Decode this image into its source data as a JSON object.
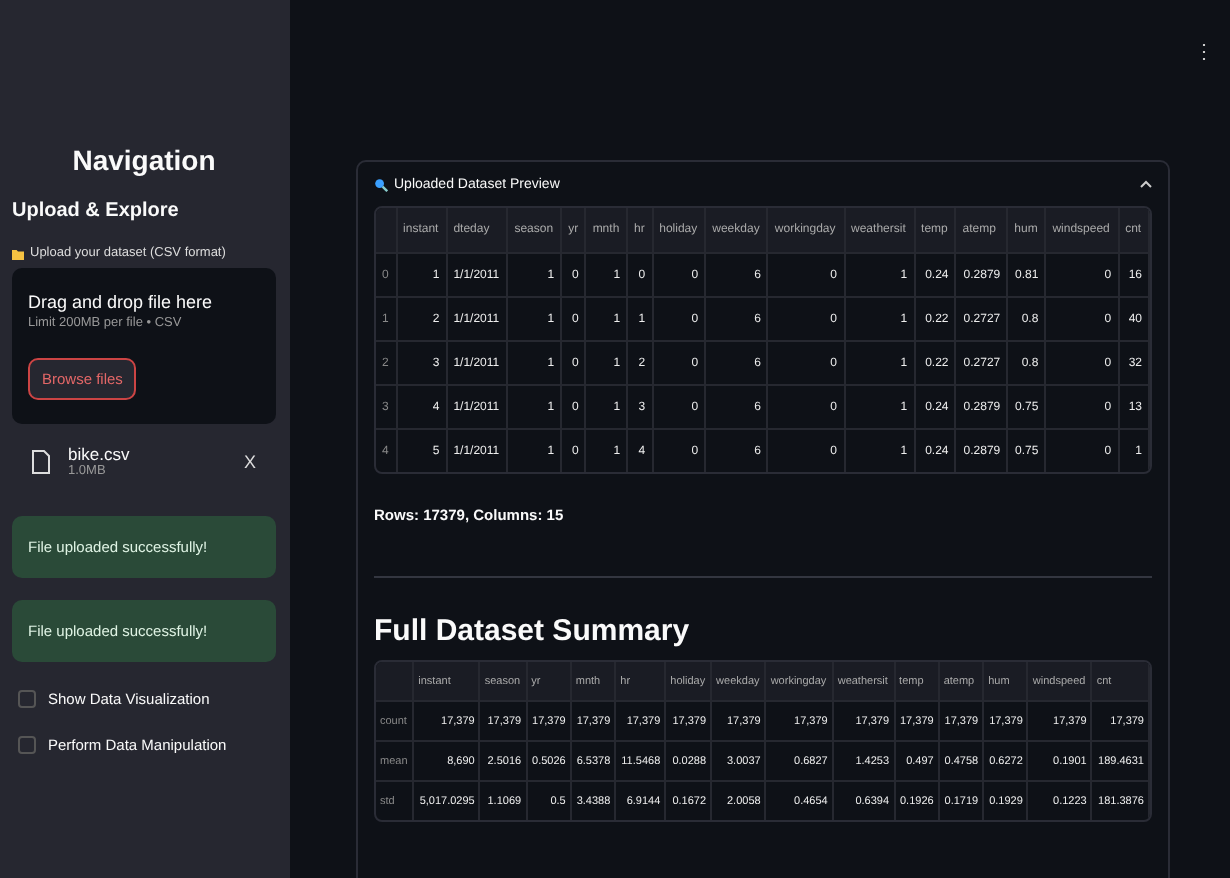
{
  "app_menu": "⋮",
  "sidebar": {
    "title": "Navigation",
    "section": "Upload & Explore",
    "uploader": {
      "label": "Upload your dataset (CSV format)",
      "dropzone_title": "Drag and drop file here",
      "dropzone_hint": "Limit 200MB per file • CSV",
      "browse_button": "Browse files",
      "file": {
        "name": "bike.csv",
        "size": "1.0MB",
        "remove": "X"
      }
    },
    "messages": [
      {
        "text": "File uploaded successfully!"
      },
      {
        "text": "File uploaded successfully!"
      }
    ],
    "checkboxes": [
      {
        "label": "Show Data Visualization",
        "checked": false
      },
      {
        "label": "Perform Data Manipulation",
        "checked": false
      }
    ]
  },
  "preview": {
    "title": "Uploaded Dataset Preview",
    "expanded": true,
    "table": {
      "columns": [
        "",
        "instant",
        "dteday",
        "season",
        "yr",
        "mnth",
        "hr",
        "holiday",
        "weekday",
        "workingday",
        "weathersit",
        "temp",
        "atemp",
        "hum",
        "windspeed",
        "cnt"
      ],
      "rows": [
        [
          "0",
          "1",
          "1/1/2011",
          "1",
          "0",
          "1",
          "0",
          "0",
          "6",
          "0",
          "1",
          "0.24",
          "0.2879",
          "0.81",
          "0",
          "16"
        ],
        [
          "1",
          "2",
          "1/1/2011",
          "1",
          "0",
          "1",
          "1",
          "0",
          "6",
          "0",
          "1",
          "0.22",
          "0.2727",
          "0.8",
          "0",
          "40"
        ],
        [
          "2",
          "3",
          "1/1/2011",
          "1",
          "0",
          "1",
          "2",
          "0",
          "6",
          "0",
          "1",
          "0.22",
          "0.2727",
          "0.8",
          "0",
          "32"
        ],
        [
          "3",
          "4",
          "1/1/2011",
          "1",
          "0",
          "1",
          "3",
          "0",
          "6",
          "0",
          "1",
          "0.24",
          "0.2879",
          "0.75",
          "0",
          "13"
        ],
        [
          "4",
          "5",
          "1/1/2011",
          "1",
          "0",
          "1",
          "4",
          "0",
          "6",
          "0",
          "1",
          "0.24",
          "0.2879",
          "0.75",
          "0",
          "1"
        ]
      ]
    },
    "shape": "Rows: 17379, Columns: 15",
    "summary_title": "Full Dataset Summary",
    "summary_table": {
      "columns": [
        "",
        "instant",
        "season",
        "yr",
        "mnth",
        "hr",
        "holiday",
        "weekday",
        "workingday",
        "weathersit",
        "temp",
        "atemp",
        "hum",
        "windspeed",
        "cnt"
      ],
      "rows": [
        [
          "count",
          "17,379",
          "17,379",
          "17,379",
          "17,379",
          "17,379",
          "17,379",
          "17,379",
          "17,379",
          "17,379",
          "17,379",
          "17,379",
          "17,379",
          "17,379",
          "17,379"
        ],
        [
          "mean",
          "8,690",
          "2.5016",
          "0.5026",
          "6.5378",
          "11.5468",
          "0.0288",
          "3.0037",
          "0.6827",
          "1.4253",
          "0.497",
          "0.4758",
          "0.6272",
          "0.1901",
          "189.4631"
        ],
        [
          "std",
          "5,017.0295",
          "1.1069",
          "0.5",
          "3.4388",
          "6.9144",
          "0.1672",
          "2.0058",
          "0.4654",
          "0.6394",
          "0.1926",
          "0.1719",
          "0.1929",
          "0.1223",
          "181.3876"
        ]
      ]
    }
  }
}
